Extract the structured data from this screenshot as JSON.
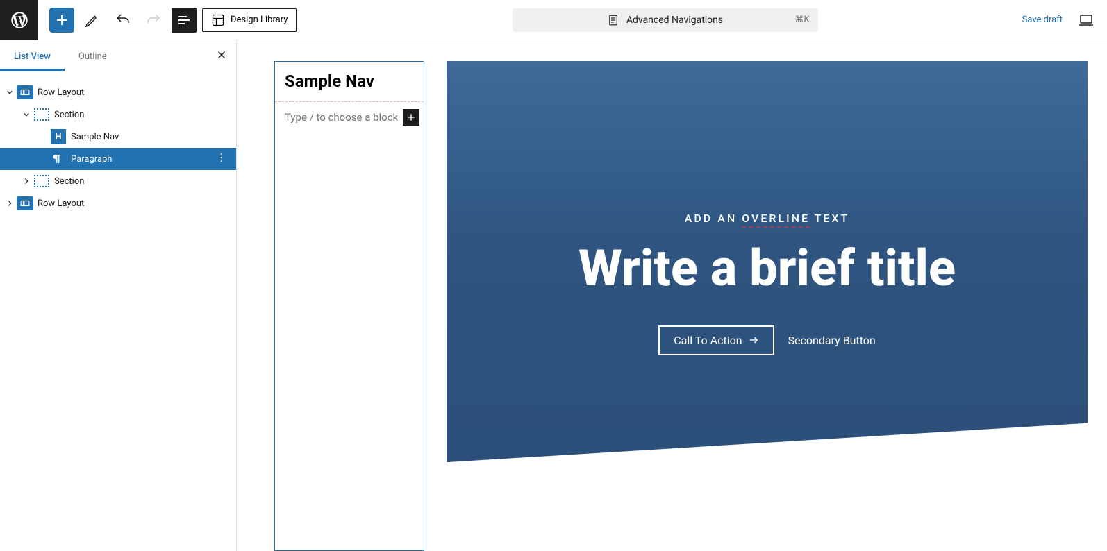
{
  "toolbar": {
    "design_library_label": "Design Library",
    "document_title": "Advanced Navigations",
    "shortcut": "⌘K",
    "save_draft_label": "Save draft"
  },
  "sidebar": {
    "tabs": {
      "list_view": "List View",
      "outline": "Outline"
    },
    "tree": {
      "row_layout_1": "Row Layout",
      "section_1": "Section",
      "sample_nav": "Sample Nav",
      "paragraph": "Paragraph",
      "section_2": "Section",
      "row_layout_2": "Row Layout"
    }
  },
  "canvas": {
    "left_column": {
      "heading": "Sample Nav",
      "placeholder": "Type / to choose a block"
    },
    "hero": {
      "overline_prefix": "ADD AN ",
      "overline_underlined": "OVERLINE",
      "overline_suffix": " TEXT",
      "title": "Write a brief title",
      "cta": "Call To Action",
      "secondary": "Secondary Button"
    }
  }
}
